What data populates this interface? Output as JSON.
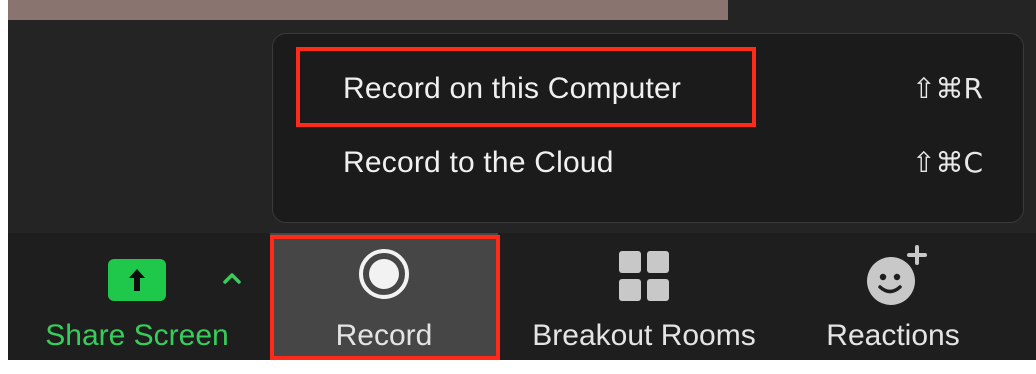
{
  "record_menu": {
    "items": [
      {
        "label": "Record on this Computer",
        "shortcut": "⇧⌘R"
      },
      {
        "label": "Record to the Cloud",
        "shortcut": "⇧⌘C"
      }
    ]
  },
  "toolbar": {
    "share_screen": {
      "label": "Share Screen",
      "icon": "share-screen-icon"
    },
    "record": {
      "label": "Record",
      "icon": "record-icon"
    },
    "breakout_rooms": {
      "label": "Breakout Rooms",
      "icon": "grid-icon"
    },
    "reactions": {
      "label": "Reactions",
      "icon": "add-reaction-icon"
    }
  },
  "colors": {
    "highlight": "#ff2a1a",
    "share_green": "#1fc74b",
    "toolbar_bg": "#1e1e1e",
    "menu_bg": "#1b1b1b"
  }
}
